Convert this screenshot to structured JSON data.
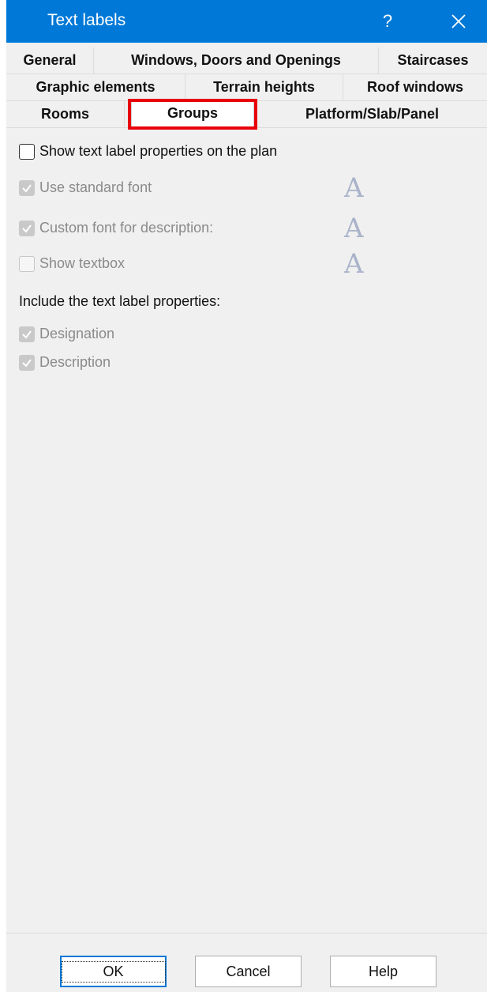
{
  "window": {
    "title": "Text labels",
    "help_glyph": "?",
    "titlebar_color": "#0078d7"
  },
  "tabs": {
    "row1": [
      "General",
      "Windows, Doors and Openings",
      "Staircases"
    ],
    "row2": [
      "Graphic elements",
      "Terrain heights",
      "Roof windows"
    ],
    "row3": [
      "Rooms",
      "Groups",
      "Platform/Slab/Panel"
    ],
    "active": "Groups",
    "highlight_color": "#e8000b"
  },
  "options": {
    "show_on_plan": {
      "label": "Show text label properties on the plan",
      "checked": false,
      "enabled": true
    },
    "standard_font": {
      "label": "Use standard font",
      "checked": true,
      "enabled": false
    },
    "custom_font": {
      "label": "Custom font for description:",
      "checked": true,
      "enabled": false
    },
    "show_textbox": {
      "label": "Show textbox",
      "checked": false,
      "enabled": false
    }
  },
  "font_icon_glyph": "A",
  "include": {
    "label": "Include the text label properties:",
    "designation": {
      "label": "Designation",
      "checked": true,
      "enabled": false
    },
    "description": {
      "label": "Description",
      "checked": true,
      "enabled": false
    }
  },
  "buttons": {
    "ok": "OK",
    "cancel": "Cancel",
    "help": "Help"
  }
}
